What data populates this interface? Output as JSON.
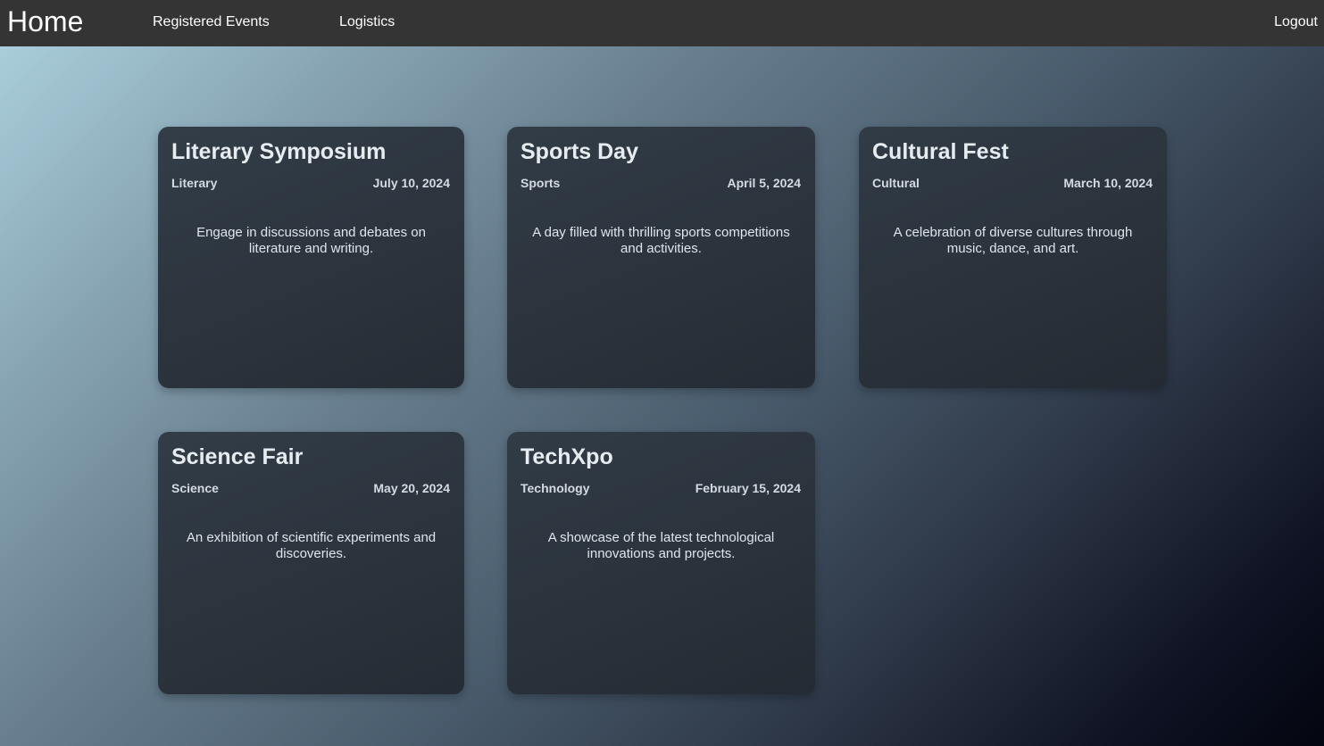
{
  "nav": {
    "home": "Home",
    "registered_events": "Registered Events",
    "logistics": "Logistics",
    "logout": "Logout"
  },
  "events": [
    {
      "title": "Literary Symposium",
      "category": "Literary",
      "date": "July 10, 2024",
      "description": "Engage in discussions and debates on literature and writing."
    },
    {
      "title": "Sports Day",
      "category": "Sports",
      "date": "April 5, 2024",
      "description": "A day filled with thrilling sports competitions and activities."
    },
    {
      "title": "Cultural Fest",
      "category": "Cultural",
      "date": "March 10, 2024",
      "description": "A celebration of diverse cultures through music, dance, and art."
    },
    {
      "title": "Science Fair",
      "category": "Science",
      "date": "May 20, 2024",
      "description": "An exhibition of scientific experiments and discoveries."
    },
    {
      "title": "TechXpo",
      "category": "Technology",
      "date": "February 15, 2024",
      "description": "A showcase of the latest technological innovations and projects."
    }
  ],
  "colors": {
    "navbar": "#343434",
    "card": "#2f3842",
    "text": "#e7ecf0"
  }
}
